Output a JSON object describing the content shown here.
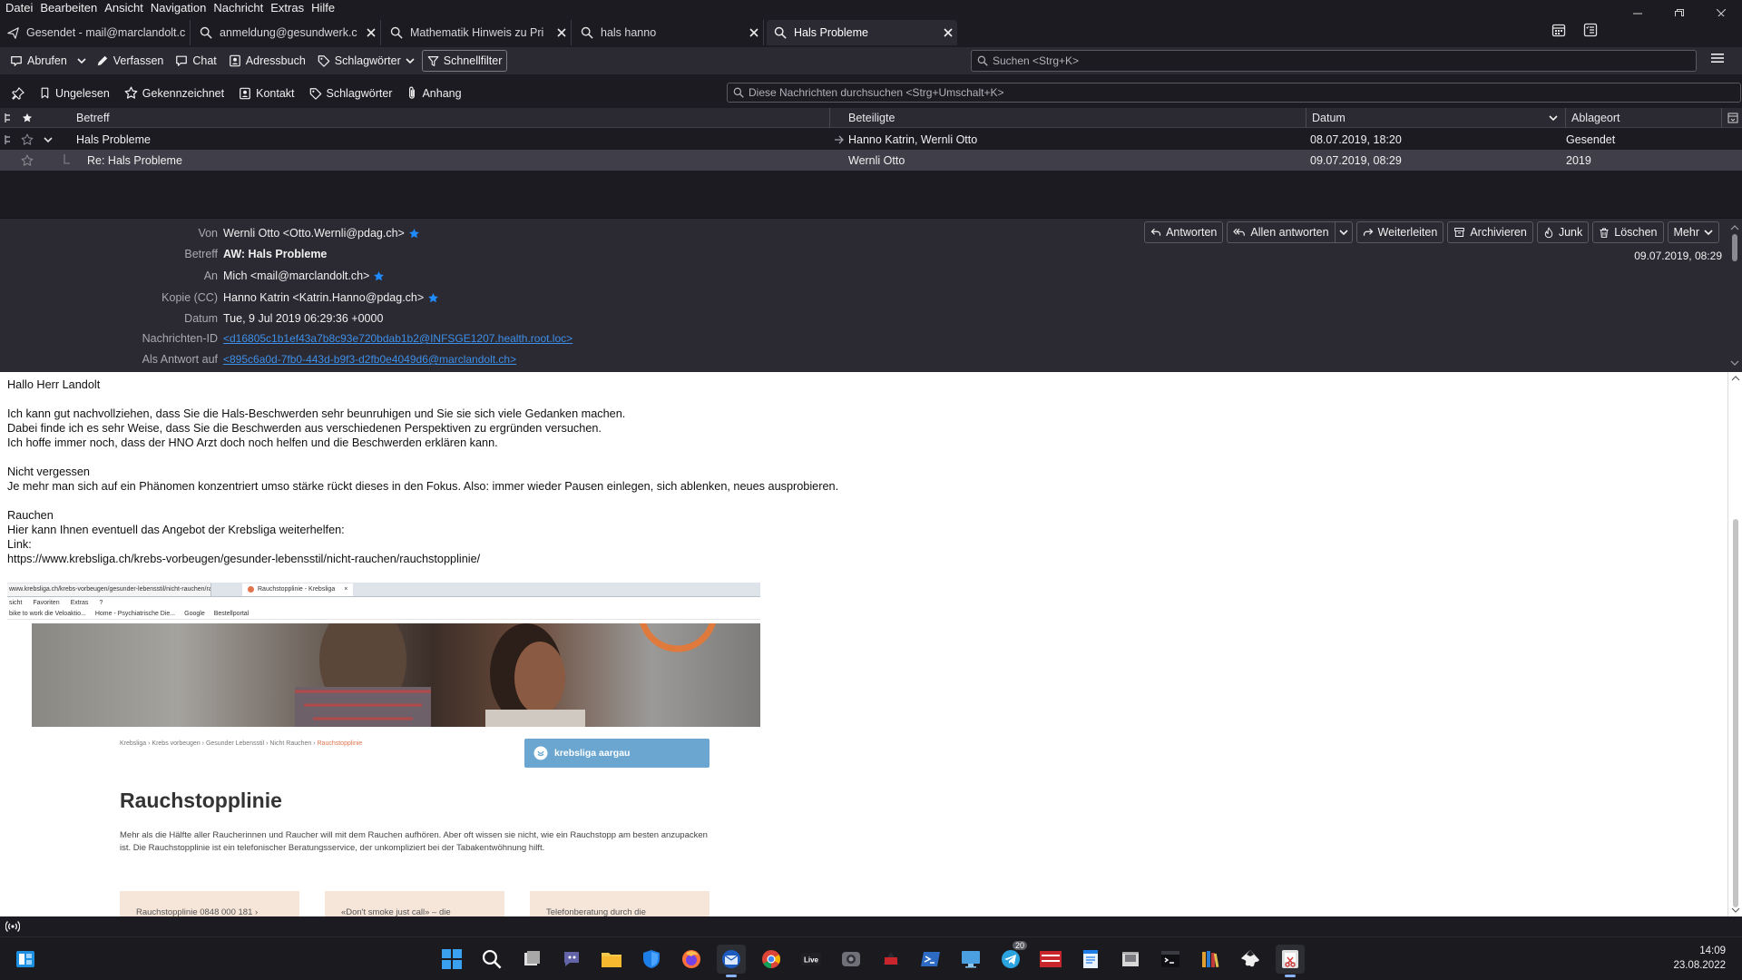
{
  "menubar": {
    "items": [
      {
        "label": "Datei"
      },
      {
        "label": "Bearbeiten"
      },
      {
        "label": "Ansicht"
      },
      {
        "label": "Navigation"
      },
      {
        "label": "Nachricht"
      },
      {
        "label": "Extras"
      },
      {
        "label": "Hilfe"
      }
    ]
  },
  "tabs": [
    {
      "label": "Gesendet - mail@marclandolt.c",
      "icon": "send-icon"
    },
    {
      "label": "anmeldung@gesundwerk.c",
      "icon": "search-icon"
    },
    {
      "label": "Mathematik Hinweis zu Pri",
      "icon": "search-icon"
    },
    {
      "label": "hals hanno",
      "icon": "search-icon"
    },
    {
      "label": "Hals Probleme",
      "icon": "search-icon"
    }
  ],
  "toolbar": {
    "get_messages": "Abrufen",
    "write": "Verfassen",
    "chat": "Chat",
    "address_book": "Adressbuch",
    "tags": "Schlagwörter",
    "quick_filter": "Schnellfilter",
    "search_placeholder": "Suchen <Strg+K>"
  },
  "quickfilter": {
    "unread": "Ungelesen",
    "starred": "Gekennzeichnet",
    "contact": "Kontakt",
    "tags": "Schlagwörter",
    "attachment": "Anhang",
    "search_placeholder": "Diese Nachrichten durchsuchen <Strg+Umschalt+K>"
  },
  "threadlist": {
    "columns": {
      "subject": "Betreff",
      "correspondents": "Beteiligte",
      "date": "Datum",
      "location": "Ablageort"
    },
    "rows": [
      {
        "subject": "Hals Probleme",
        "correspondents": "Hanno Katrin, Wernli Otto",
        "date": "08.07.2019, 18:20",
        "location": "Gesendet"
      },
      {
        "subject": "Re: Hals Probleme",
        "correspondents": "Wernli Otto",
        "date": "09.07.2019, 08:29",
        "location": "2019"
      }
    ]
  },
  "header": {
    "from_label": "Von",
    "from": "Wernli Otto <Otto.Wernli@pdag.ch>",
    "subject_label": "Betreff",
    "subject": "AW: Hals Probleme",
    "to_label": "An",
    "to": "Mich <mail@marclandolt.ch>",
    "cc_label": "Kopie (CC)",
    "cc": "Hanno Katrin <Katrin.Hanno@pdag.ch>",
    "date_label": "Datum",
    "date": "Tue, 9 Jul 2019 06:29:36 +0000",
    "msgid_label": "Nachrichten-ID",
    "msgid": "<d16805c1b1ef43a7b8c93e720bdab1b2@INFSGE1207.health.root.loc>",
    "inreplyto_label": "Als Antwort auf",
    "inreplyto": "<895c6a0d-7fb0-443d-b9f3-d2fb0e4049d6@marclandolt.ch>",
    "short_date": "09.07.2019, 08:29",
    "actions": {
      "reply": "Antworten",
      "reply_all": "Allen antworten",
      "forward": "Weiterleiten",
      "archive": "Archivieren",
      "junk": "Junk",
      "delete": "Löschen",
      "more": "Mehr"
    }
  },
  "body": {
    "lines": [
      "Hallo Herr Landolt",
      "",
      "Ich kann gut nachvollziehen, dass Sie die Hals-Beschwerden sehr beunruhigen und Sie sie sich viele Gedanken machen.",
      "Dabei finde ich es sehr Weise, dass Sie die Beschwerden aus verschiedenen Perspektiven zu ergründen versuchen.",
      "Ich hoffe immer noch, dass der HNO Arzt doch noch helfen und die Beschwerden erklären kann.",
      "",
      "Nicht vergessen",
      "Je mehr man sich auf ein Phänomen konzentriert umso stärke rückt dieses in den Fokus. Also: immer wieder Pausen einlegen, sich ablenken, neues ausprobieren.",
      "",
      "Rauchen",
      "Hier kann Ihnen eventuell das Angebot der Krebsliga weiterhelfen:",
      "Link:",
      "https://www.krebsliga.ch/krebs-vorbeugen/gesunder-lebensstil/nicht-rauchen/rauchstopplinie/"
    ]
  },
  "embed": {
    "address": "www.krebsliga.ch/krebs-vorbeugen/gesunder-lebensstil/nicht-rauchen/rauch",
    "tab_title": "Rauchstopplinie - Krebsliga",
    "menu": [
      "sicht",
      "Favoriten",
      "Extras",
      "?"
    ],
    "favorites": [
      "bike to work die Velоaktio...",
      "Home - Psychiatrische Die...",
      "Google",
      "Bestellportal"
    ],
    "breadcrumbs": "Krebsliga › Krebs vorbeugen › Gesunder Lebensstil › Nicht Rauchen › ",
    "breadcrumb_current": "Rauchstopplinie",
    "badge": "krebsliga aargau",
    "title": "Rauchstopplinie",
    "lead": "Mehr als die Hälfte aller Raucherinnen und Raucher will mit dem Rauchen aufhören. Aber oft wissen sie nicht, wie ein Rauchstopp am besten anzupacken ist. Die Rauchstopplinie ist ein telefonischer Beratungsservice, der unkompliziert bei der Tabakentwöhnung hilft.",
    "cards": [
      "Rauchstopplinie 0848 000 181  ›",
      "«Don't smoke just call» – die",
      "Telefonberatung durch die"
    ]
  },
  "taskbar": {
    "time": "14:09",
    "date": "23.08.2022",
    "telegram_badge": "20"
  },
  "colors": {
    "accent": "#0a84ff",
    "link": "#3d8fe8",
    "star": "#1f8bff",
    "dark_bg": "#1c1b22",
    "panel_bg": "#2b2a33"
  }
}
